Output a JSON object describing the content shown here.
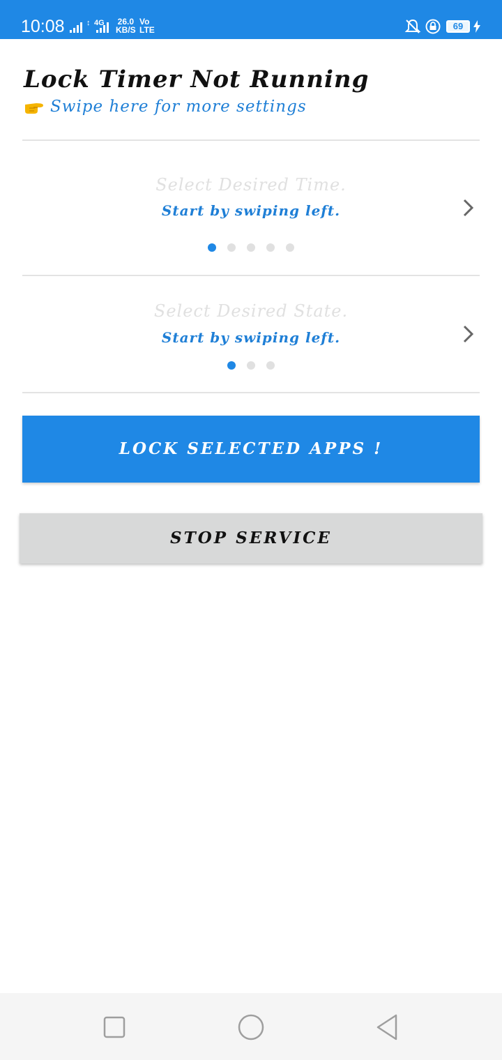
{
  "status_bar": {
    "time": "10:08",
    "network_label": "4G",
    "speed_value": "26.0",
    "speed_unit": "KB/S",
    "volte_top": "Vo",
    "volte_bottom": "LTE",
    "battery": "69",
    "icons": [
      "signal-icon",
      "data-arrows-icon",
      "signal-icon",
      "bell-off-icon",
      "vpn-lock-icon",
      "battery-icon",
      "charging-icon"
    ],
    "color": "#1f88e5"
  },
  "header": {
    "title": "Lock Timer Not Running",
    "subtitle": "Swipe here for more settings",
    "subtitle_icon": "pointing-hand-icon"
  },
  "time_selector": {
    "title": "Select Desired Time.",
    "hint": "Start by swiping left.",
    "page_count": 5,
    "active_page": 1,
    "icon": "chevron-right-icon"
  },
  "state_selector": {
    "title": "Select Desired State.",
    "hint": "Start by swiping left.",
    "page_count": 3,
    "active_page": 1,
    "icon": "chevron-right-icon"
  },
  "buttons": {
    "lock_label": "LOCK SELECTED APPS !",
    "stop_label": "STOP SERVICE"
  },
  "colors": {
    "accent": "#1f88e5",
    "secondary_button": "#d8d9d9",
    "inactive_dot": "#e0e0e0"
  },
  "navigation": {
    "icons": [
      "recents-square-icon",
      "home-circle-icon",
      "back-triangle-icon"
    ]
  }
}
